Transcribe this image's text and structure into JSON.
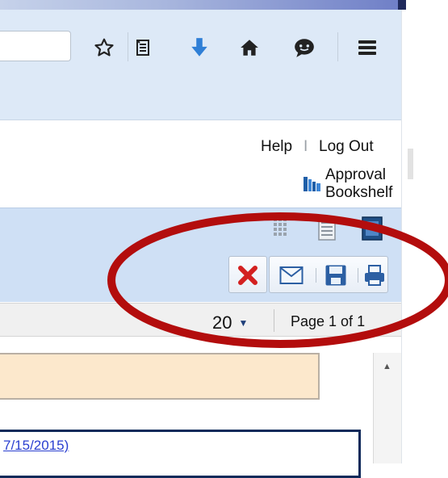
{
  "browser": {
    "icons": [
      "star-icon",
      "reading-list-icon",
      "download-icon",
      "home-icon",
      "chat-icon",
      "menu-icon"
    ],
    "accent_color": "#2f7fd6"
  },
  "header": {
    "help": "Help",
    "separator": "I",
    "logout": "Log Out",
    "bookshelf": "Approval Bookshelf"
  },
  "toolbar": {
    "view_icons": [
      "grid-view-icon",
      "list-view-icon",
      "detail-view-icon"
    ],
    "buttons": [
      "delete-icon",
      "email-icon",
      "save-icon",
      "print-icon"
    ],
    "delete_color": "#d32020"
  },
  "pager": {
    "page_size": "20",
    "page_label": "Page 1 of 1"
  },
  "list": {
    "record_text": "7/15/2015)"
  },
  "annotation": {
    "highlight_color": "#b30d0d"
  }
}
